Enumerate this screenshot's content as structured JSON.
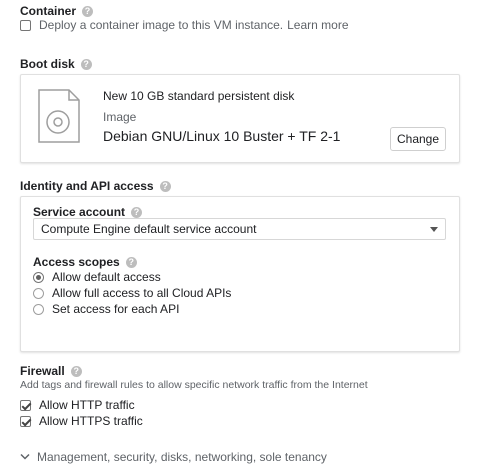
{
  "container": {
    "title": "Container",
    "checkbox_label": "Deploy a container image to this VM instance.",
    "learn_more": "Learn more",
    "checked": false
  },
  "boot_disk": {
    "title": "Boot disk",
    "description": "New 10 GB standard persistent disk",
    "image_label": "Image",
    "image_name": "Debian GNU/Linux 10 Buster + TF 2-1",
    "change_button": "Change"
  },
  "identity": {
    "title": "Identity and API access",
    "service_account_label": "Service account",
    "service_account_value": "Compute Engine default service account",
    "access_scopes_label": "Access scopes",
    "scopes": [
      {
        "label": "Allow default access",
        "selected": true
      },
      {
        "label": "Allow full access to all Cloud APIs",
        "selected": false
      },
      {
        "label": "Set access for each API",
        "selected": false
      }
    ]
  },
  "firewall": {
    "title": "Firewall",
    "description": "Add tags and firewall rules to allow specific network traffic from the Internet",
    "options": [
      {
        "label": "Allow HTTP traffic",
        "checked": true
      },
      {
        "label": "Allow HTTPS traffic",
        "checked": true
      }
    ]
  },
  "more": {
    "label": "Management, security, disks, networking, sole tenancy"
  },
  "icons": {
    "help": "help-icon",
    "disk": "disk-image-icon",
    "dropdown": "dropdown-arrow-icon",
    "expand": "chevron-down-icon"
  }
}
